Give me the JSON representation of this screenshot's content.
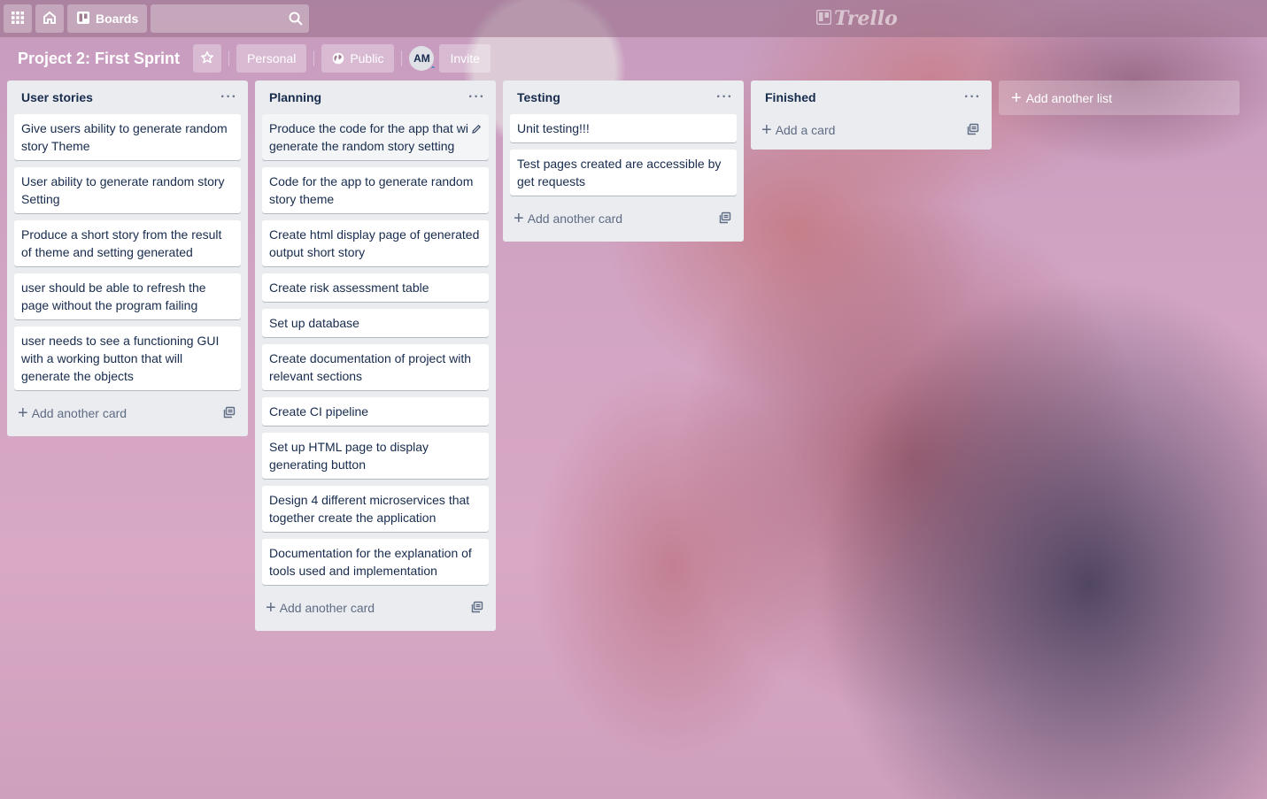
{
  "header": {
    "boards_label": "Boards",
    "search_placeholder": "",
    "logo_text": "Trello"
  },
  "board": {
    "title": "Project 2: First Sprint",
    "visibility_team": "Personal",
    "visibility_access": "Public",
    "member_initials": "AM",
    "invite_label": "Invite"
  },
  "lists": [
    {
      "title": "User stories",
      "cards": [
        "Give users ability to generate random story Theme",
        "User ability to generate random story Setting",
        "Produce a short story from the result of theme and setting generated",
        "user should be able to refresh the page without the program failing",
        "user needs to see a functioning GUI with a working button that will generate the objects"
      ],
      "add_label": "Add another card"
    },
    {
      "title": "Planning",
      "cards": [
        "Produce the code for the app that wi generate the random story setting",
        "Code for the app to generate random story theme",
        "Create html display page of generated output short story",
        "Create risk assessment table",
        "Set up database",
        "Create documentation of project with relevant sections",
        "Create CI pipeline",
        "Set up HTML page to display generating button",
        "Design 4 different microservices that together create the application",
        "Documentation for the explanation of tools used and implementation"
      ],
      "add_label": "Add another card"
    },
    {
      "title": "Testing",
      "cards": [
        "Unit testing!!!",
        "Test pages created are accessible by get requests"
      ],
      "add_label": "Add another card"
    },
    {
      "title": "Finished",
      "cards": [],
      "add_label": "Add a card"
    }
  ],
  "add_list_label": "Add another list",
  "icons": {
    "apps": "apps-grid-icon",
    "home": "home-icon",
    "boards": "boards-icon",
    "search": "search-icon",
    "star": "star-icon",
    "globe": "globe-icon",
    "menu": "more-dots-icon",
    "template": "card-template-icon",
    "edit": "pencil-icon"
  }
}
